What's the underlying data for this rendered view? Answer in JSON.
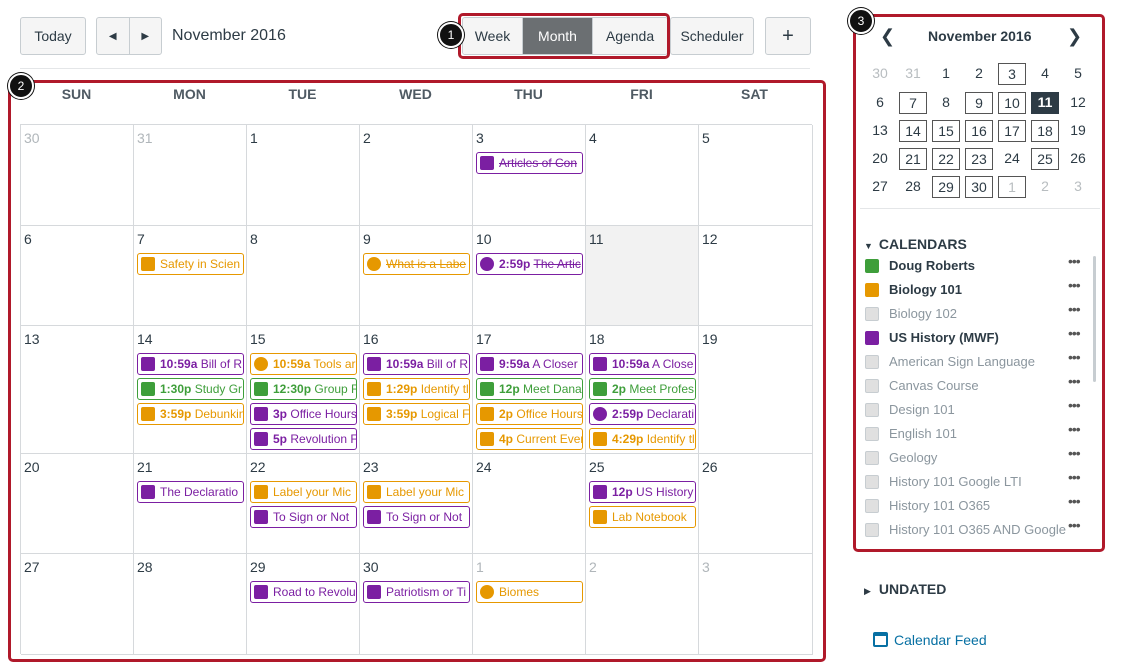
{
  "toolbar": {
    "today_label": "Today",
    "month_title": "November 2016",
    "views": [
      "Week",
      "Month",
      "Agenda"
    ],
    "active_view": "Month",
    "scheduler_label": "Scheduler",
    "add_label": "+"
  },
  "badges": [
    "1",
    "2",
    "3"
  ],
  "weekdays": [
    "SUN",
    "MON",
    "TUE",
    "WED",
    "THU",
    "FRI",
    "SAT"
  ],
  "colors": {
    "purple": "#7b1fa2",
    "orange": "#e69800",
    "green": "#3e9e3a"
  },
  "weeks": [
    {
      "days": [
        {
          "n": "30",
          "other": true,
          "events": []
        },
        {
          "n": "31",
          "other": true,
          "events": []
        },
        {
          "n": "1",
          "events": []
        },
        {
          "n": "2",
          "events": []
        },
        {
          "n": "3",
          "events": [
            {
              "color": "purple",
              "icon": "discussion-icon",
              "time": "",
              "title": "Articles of Con",
              "done": true
            }
          ]
        },
        {
          "n": "4",
          "events": []
        },
        {
          "n": "5",
          "events": []
        }
      ]
    },
    {
      "days": [
        {
          "n": "6",
          "events": []
        },
        {
          "n": "7",
          "events": [
            {
              "color": "orange",
              "icon": "assignment-icon",
              "time": "",
              "title": "Safety in Scien"
            }
          ]
        },
        {
          "n": "8",
          "events": []
        },
        {
          "n": "9",
          "events": [
            {
              "color": "orange",
              "icon": "quiz-icon",
              "time": "",
              "title": "What is a Labe",
              "done": true
            }
          ]
        },
        {
          "n": "10",
          "events": [
            {
              "color": "purple",
              "icon": "quiz-icon",
              "time": "2:59p",
              "title": "The Artic",
              "done": true
            }
          ]
        },
        {
          "n": "11",
          "today": true,
          "events": []
        },
        {
          "n": "12",
          "events": []
        }
      ]
    },
    {
      "days": [
        {
          "n": "13",
          "events": []
        },
        {
          "n": "14",
          "events": [
            {
              "color": "purple",
              "icon": "discussion-icon",
              "time": "10:59a",
              "title": "Bill of R"
            },
            {
              "color": "green",
              "icon": "calendar-event-icon",
              "time": "1:30p",
              "title": "Study Gr"
            },
            {
              "color": "orange",
              "icon": "assignment-icon",
              "time": "3:59p",
              "title": "Debunkin"
            }
          ]
        },
        {
          "n": "15",
          "events": [
            {
              "color": "orange",
              "icon": "quiz-icon",
              "time": "10:59a",
              "title": "Tools ar"
            },
            {
              "color": "green",
              "icon": "calendar-event-icon",
              "time": "12:30p",
              "title": "Group F"
            },
            {
              "color": "purple",
              "icon": "calendar-event-icon",
              "time": "3p",
              "title": "Office Hours"
            },
            {
              "color": "purple",
              "icon": "assignment-icon",
              "time": "5p",
              "title": "Revolution F"
            }
          ]
        },
        {
          "n": "16",
          "events": [
            {
              "color": "purple",
              "icon": "discussion-icon",
              "time": "10:59a",
              "title": "Bill of R"
            },
            {
              "color": "orange",
              "icon": "discussion-icon",
              "time": "1:29p",
              "title": "Identify tl"
            },
            {
              "color": "orange",
              "icon": "assignment-icon",
              "time": "3:59p",
              "title": "Logical F"
            }
          ]
        },
        {
          "n": "17",
          "events": [
            {
              "color": "purple",
              "icon": "assignment-icon",
              "time": "9:59a",
              "title": "A Closer"
            },
            {
              "color": "green",
              "icon": "calendar-event-icon",
              "time": "12p",
              "title": "Meet Dana"
            },
            {
              "color": "orange",
              "icon": "calendar-event-icon",
              "time": "2p",
              "title": "Office Hours"
            },
            {
              "color": "orange",
              "icon": "discussion-icon",
              "time": "4p",
              "title": "Current Ever"
            }
          ]
        },
        {
          "n": "18",
          "events": [
            {
              "color": "purple",
              "icon": "assignment-icon",
              "time": "10:59a",
              "title": "A Close"
            },
            {
              "color": "green",
              "icon": "calendar-event-icon",
              "time": "2p",
              "title": "Meet Profes"
            },
            {
              "color": "purple",
              "icon": "quiz-icon",
              "time": "2:59p",
              "title": "Declarati"
            },
            {
              "color": "orange",
              "icon": "discussion-icon",
              "time": "4:29p",
              "title": "Identify tl"
            }
          ]
        },
        {
          "n": "19",
          "events": []
        }
      ]
    },
    {
      "days": [
        {
          "n": "20",
          "events": []
        },
        {
          "n": "21",
          "events": [
            {
              "color": "purple",
              "icon": "assignment-icon",
              "time": "",
              "title": "The Declaratio"
            }
          ]
        },
        {
          "n": "22",
          "events": [
            {
              "color": "orange",
              "icon": "assignment-icon",
              "time": "",
              "title": "Label your Mic"
            },
            {
              "color": "purple",
              "icon": "discussion-icon",
              "time": "",
              "title": "To Sign or Not"
            }
          ]
        },
        {
          "n": "23",
          "events": [
            {
              "color": "orange",
              "icon": "assignment-icon",
              "time": "",
              "title": "Label your Mic"
            },
            {
              "color": "purple",
              "icon": "discussion-icon",
              "time": "",
              "title": "To Sign or Not"
            }
          ]
        },
        {
          "n": "24",
          "events": []
        },
        {
          "n": "25",
          "events": [
            {
              "color": "purple",
              "icon": "calendar-event-icon",
              "time": "12p",
              "title": "US History"
            },
            {
              "color": "orange",
              "icon": "assignment-icon",
              "time": "",
              "title": "Lab Notebook"
            }
          ]
        },
        {
          "n": "26",
          "events": []
        }
      ]
    },
    {
      "days": [
        {
          "n": "27",
          "events": []
        },
        {
          "n": "28",
          "events": []
        },
        {
          "n": "29",
          "events": [
            {
              "color": "purple",
              "icon": "discussion-icon",
              "time": "",
              "title": "Road to Revolu"
            }
          ]
        },
        {
          "n": "30",
          "events": [
            {
              "color": "purple",
              "icon": "assignment-icon",
              "time": "",
              "title": "Patriotism or Ti"
            }
          ]
        },
        {
          "n": "1",
          "other": true,
          "events": [
            {
              "color": "orange",
              "icon": "quiz-icon",
              "time": "",
              "title": "Biomes"
            }
          ]
        },
        {
          "n": "2",
          "other": true,
          "events": []
        },
        {
          "n": "3",
          "other": true,
          "events": []
        }
      ]
    }
  ],
  "mini_calendar": {
    "title": "November 2016",
    "prev": "‹",
    "next": "›",
    "weeks": [
      [
        {
          "n": "30",
          "other": true
        },
        {
          "n": "31",
          "other": true
        },
        {
          "n": "1"
        },
        {
          "n": "2"
        },
        {
          "n": "3",
          "boxed": true
        },
        {
          "n": "4"
        },
        {
          "n": "5"
        }
      ],
      [
        {
          "n": "6"
        },
        {
          "n": "7",
          "boxed": true
        },
        {
          "n": "8"
        },
        {
          "n": "9",
          "boxed": true
        },
        {
          "n": "10",
          "boxed": true
        },
        {
          "n": "11",
          "selected": true
        },
        {
          "n": "12"
        }
      ],
      [
        {
          "n": "13"
        },
        {
          "n": "14",
          "boxed": true
        },
        {
          "n": "15",
          "boxed": true
        },
        {
          "n": "16",
          "boxed": true
        },
        {
          "n": "17",
          "boxed": true
        },
        {
          "n": "18",
          "boxed": true
        },
        {
          "n": "19"
        }
      ],
      [
        {
          "n": "20"
        },
        {
          "n": "21",
          "boxed": true
        },
        {
          "n": "22",
          "boxed": true
        },
        {
          "n": "23",
          "boxed": true
        },
        {
          "n": "24"
        },
        {
          "n": "25",
          "boxed": true
        },
        {
          "n": "26"
        }
      ],
      [
        {
          "n": "27"
        },
        {
          "n": "28"
        },
        {
          "n": "29",
          "boxed": true
        },
        {
          "n": "30",
          "boxed": true
        },
        {
          "n": "1",
          "other": true,
          "boxed": true
        },
        {
          "n": "2",
          "other": true
        },
        {
          "n": "3",
          "other": true
        }
      ]
    ]
  },
  "calendars_section": {
    "title": "CALENDARS",
    "items": [
      {
        "name": "Doug Roberts",
        "color": "#3e9e3a",
        "enabled": true
      },
      {
        "name": "Biology 101",
        "color": "#e69800",
        "enabled": true
      },
      {
        "name": "Biology 102",
        "color": "#e0e0e0",
        "enabled": false
      },
      {
        "name": "US History (MWF)",
        "color": "#7b1fa2",
        "enabled": true
      },
      {
        "name": "American Sign Language",
        "color": "#e0e0e0",
        "enabled": false
      },
      {
        "name": "Canvas Course",
        "color": "#e0e0e0",
        "enabled": false
      },
      {
        "name": "Design 101",
        "color": "#e0e0e0",
        "enabled": false
      },
      {
        "name": "English 101",
        "color": "#e0e0e0",
        "enabled": false
      },
      {
        "name": "Geology",
        "color": "#e0e0e0",
        "enabled": false
      },
      {
        "name": "History 101 Google LTI",
        "color": "#e0e0e0",
        "enabled": false
      },
      {
        "name": "History 101 O365",
        "color": "#e0e0e0",
        "enabled": false
      },
      {
        "name": "History 101 O365 AND Google",
        "color": "#e0e0e0",
        "enabled": false
      }
    ],
    "more_label": "•••"
  },
  "undated": {
    "title": "UNDATED"
  },
  "feed": {
    "label": "Calendar Feed"
  }
}
